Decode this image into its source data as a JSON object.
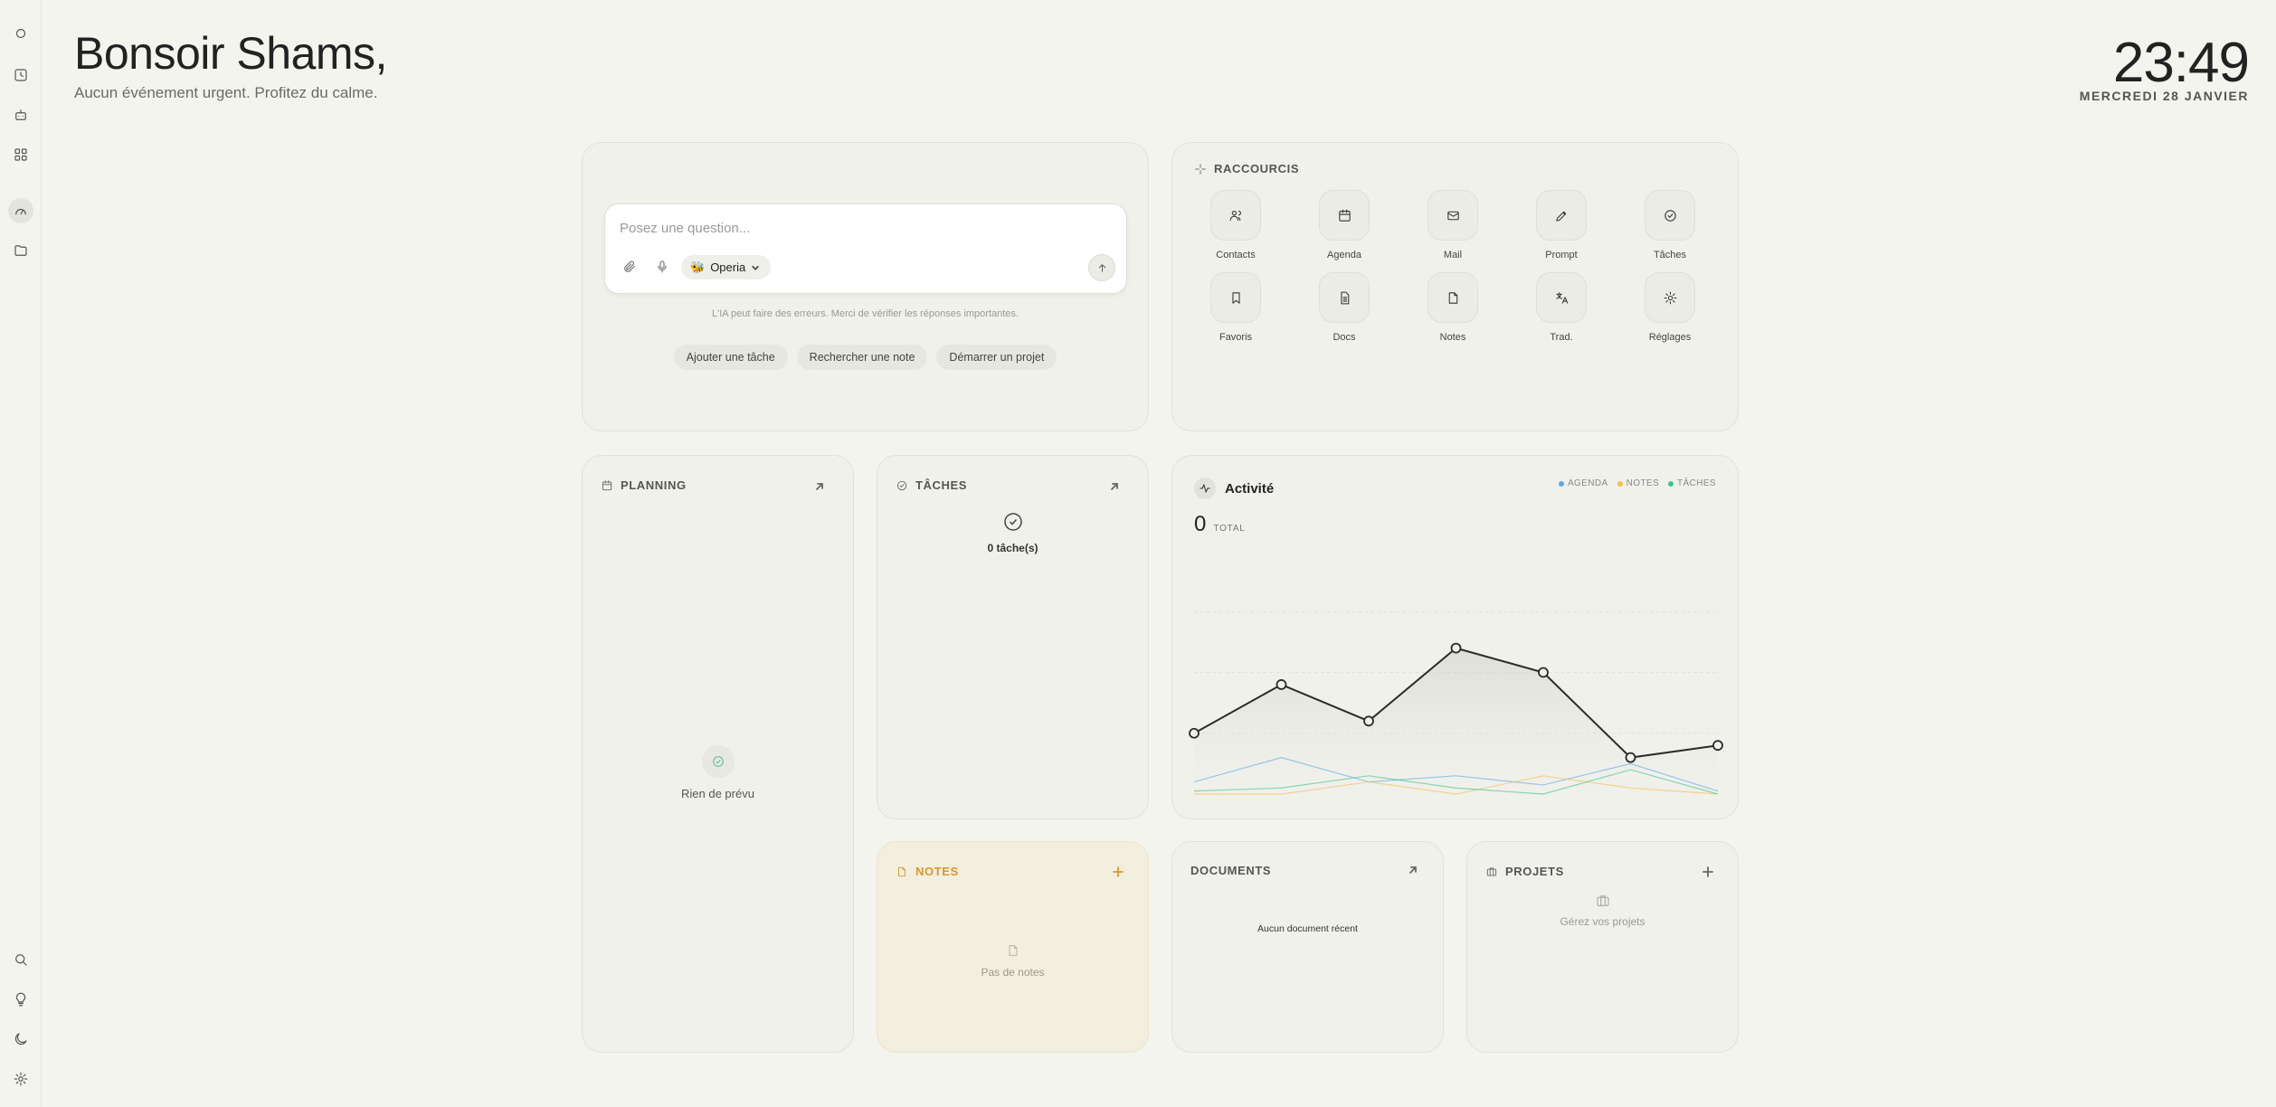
{
  "sidebar": {
    "top_items": [
      "circle-icon",
      "clock-icon",
      "bot-icon",
      "grid-icon",
      "dashboard-icon",
      "folder-icon"
    ],
    "bottom_items": [
      "search-icon",
      "lightbulb-icon",
      "moon-icon",
      "gear-icon"
    ]
  },
  "header": {
    "greeting": "Bonsoir Shams,",
    "subtitle": "Aucun événement urgent. Profitez du calme.",
    "time": "23:49",
    "date": "MERCREDI 28 JANVIER"
  },
  "ask": {
    "placeholder": "Posez une question...",
    "model": "Operia",
    "disclaimer": "L'IA peut faire des erreurs. Merci de vérifier les réponses importantes.",
    "suggestions": [
      "Ajouter une tâche",
      "Rechercher une note",
      "Démarrer un projet"
    ]
  },
  "shortcuts": {
    "title": "RACCOURCIS",
    "items": [
      {
        "label": "Contacts",
        "icon": "users-icon"
      },
      {
        "label": "Agenda",
        "icon": "calendar-icon"
      },
      {
        "label": "Mail",
        "icon": "mail-icon"
      },
      {
        "label": "Prompt",
        "icon": "pen-icon"
      },
      {
        "label": "Tâches",
        "icon": "check-circle-icon"
      },
      {
        "label": "Favoris",
        "icon": "bookmark-icon"
      },
      {
        "label": "Docs",
        "icon": "doc-icon"
      },
      {
        "label": "Notes",
        "icon": "note-icon"
      },
      {
        "label": "Trad.",
        "icon": "translate-icon"
      },
      {
        "label": "Réglages",
        "icon": "gear-icon"
      }
    ]
  },
  "planning": {
    "title": "PLANNING",
    "empty": "Rien de prévu"
  },
  "tasks": {
    "title": "TÂCHES",
    "count": "0 tâche(s)"
  },
  "activity": {
    "title": "Activité",
    "total_value": "0",
    "total_label": "TOTAL",
    "legend": [
      {
        "name": "AGENDA",
        "color": "#5aa9e6"
      },
      {
        "name": "NOTES",
        "color": "#f2c14e"
      },
      {
        "name": "TÂCHES",
        "color": "#3cc48a"
      }
    ]
  },
  "chart_data": {
    "type": "line",
    "title": "",
    "xlabel": "",
    "ylabel": "",
    "ylim": [
      0,
      4
    ],
    "grid": true,
    "legend_position": "top-right",
    "x": [
      1,
      2,
      3,
      4,
      5,
      6,
      7
    ],
    "series": [
      {
        "values": [
          1.0,
          1.8,
          1.2,
          2.4,
          2.0,
          0.6,
          0.8
        ],
        "color": "#2b2b2b"
      },
      {
        "name": "AGENDA",
        "values": [
          0.2,
          0.6,
          0.2,
          0.3,
          0.15,
          0.5,
          0.05
        ],
        "color": "#5aa9e6"
      },
      {
        "name": "NOTES",
        "values": [
          0.0,
          0.0,
          0.2,
          0.0,
          0.3,
          0.1,
          0.0
        ],
        "color": "#f2c14e"
      },
      {
        "name": "TÂCHES",
        "values": [
          0.05,
          0.1,
          0.3,
          0.1,
          0.0,
          0.4,
          0.0
        ],
        "color": "#3cc48a"
      }
    ]
  },
  "notes": {
    "title": "NOTES",
    "empty": "Pas de notes",
    "accent": "#e0a030"
  },
  "documents": {
    "title": "DOCUMENTS",
    "empty": "Aucun document récent"
  },
  "projects": {
    "title": "PROJETS",
    "empty": "Gérez vos projets"
  }
}
